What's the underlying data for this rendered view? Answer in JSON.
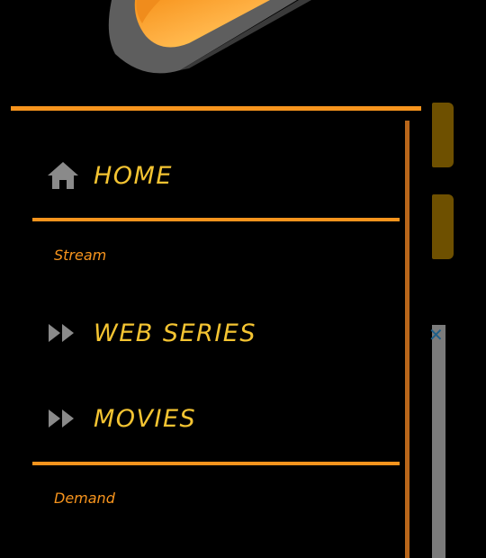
{
  "colors": {
    "background": "#000000",
    "accent": "#f7941d",
    "label": "#f4c432",
    "icon": "#8a8a8a"
  },
  "logo": {
    "icon": "app-logo"
  },
  "menu": {
    "items": [
      {
        "label": "HOME",
        "icon": "home-icon"
      },
      {
        "label": "WEB SERIES",
        "icon": "fast-forward-icon"
      },
      {
        "label": "MOVIES",
        "icon": "fast-forward-icon"
      }
    ]
  },
  "sections": {
    "stream": "Stream",
    "demand": "Demand"
  },
  "close": {
    "glyph": "✕"
  }
}
